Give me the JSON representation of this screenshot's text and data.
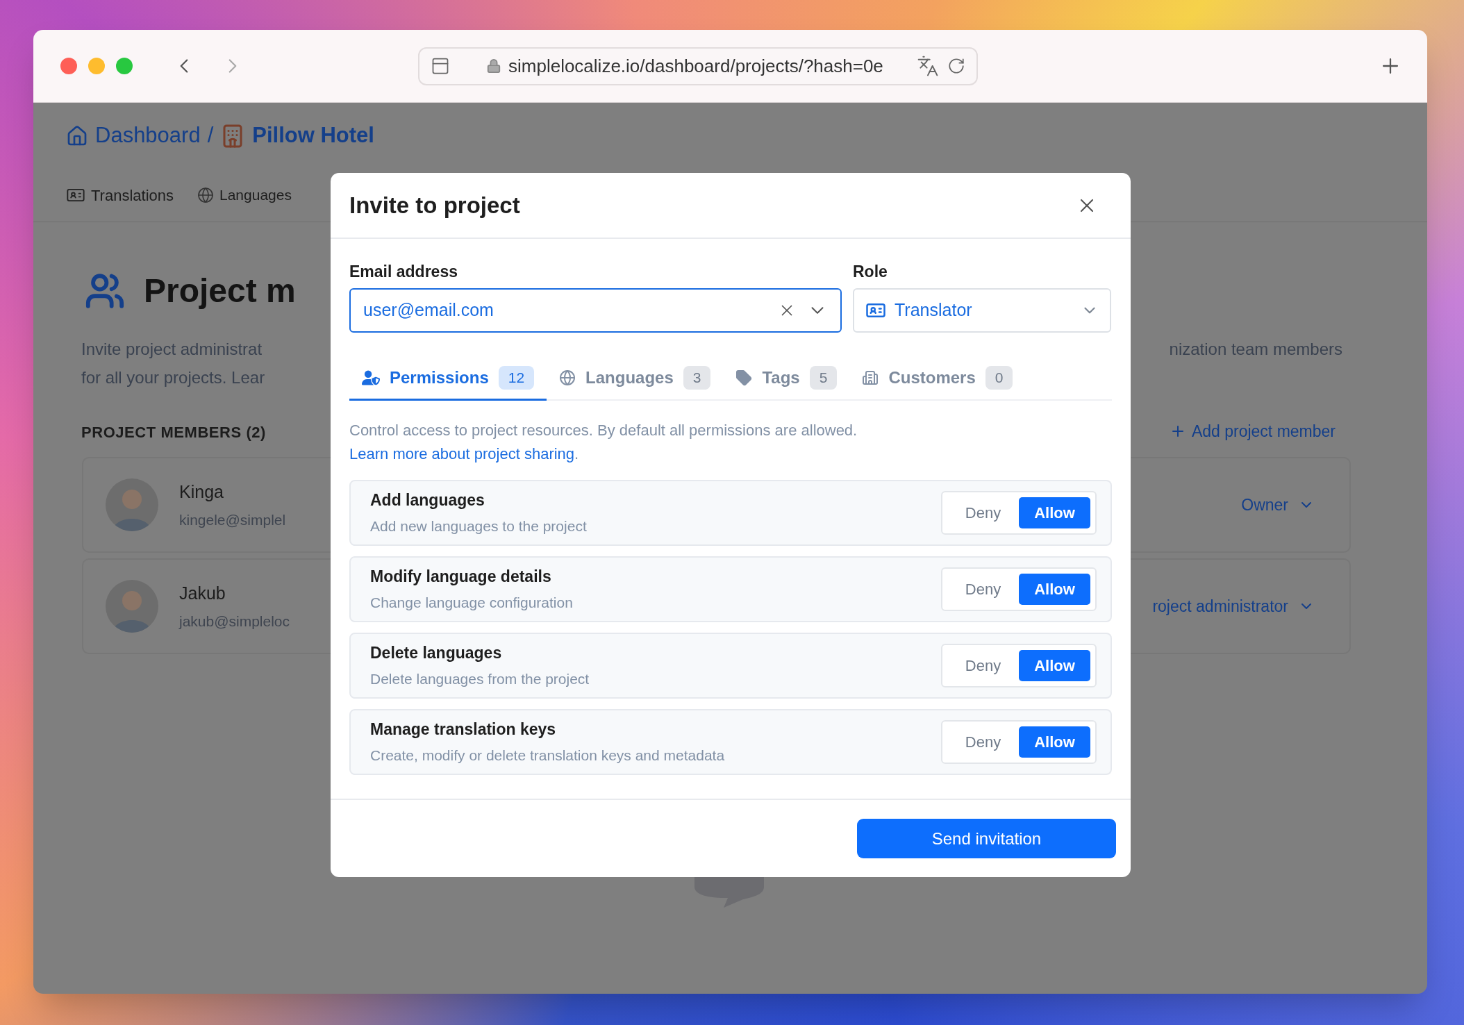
{
  "browser": {
    "url": "simplelocalize.io/dashboard/projects/?hash=0e"
  },
  "page": {
    "breadcrumb": {
      "home": "Dashboard",
      "separator": "/",
      "project": "Pillow Hotel"
    },
    "tabs": [
      "Translations",
      "Languages"
    ],
    "heading": "Project m",
    "description": [
      "Invite project administrat",
      "for all your projects. Lear"
    ],
    "description_right": "nization team members",
    "members_title": "PROJECT MEMBERS (2)",
    "add_member": "Add project member",
    "members": [
      {
        "name": "Kinga",
        "email": "kingele@simplel",
        "role": "Owner"
      },
      {
        "name": "Jakub",
        "email": "jakub@simpleloc",
        "role": "roject administrator"
      }
    ]
  },
  "modal": {
    "title": "Invite to project",
    "email": {
      "label": "Email address",
      "value": "user@email.com"
    },
    "role": {
      "label": "Role",
      "value": "Translator"
    },
    "tabs": [
      {
        "kind": "permissions",
        "label": "Permissions",
        "count": "12",
        "selected": true
      },
      {
        "kind": "languages",
        "label": "Languages",
        "count": "3",
        "selected": false
      },
      {
        "kind": "tags",
        "label": "Tags",
        "count": "5",
        "selected": false
      },
      {
        "kind": "customers",
        "label": "Customers",
        "count": "0",
        "selected": false
      }
    ],
    "description": {
      "text": "Control access to project resources. By default all permissions are allowed.",
      "link": "Learn more about project sharing",
      "tail": "."
    },
    "permissions": [
      {
        "title": "Add languages",
        "subtitle": "Add new languages to the project",
        "options": [
          {
            "label": "Deny",
            "selected": false
          },
          {
            "label": "Allow",
            "selected": true
          }
        ]
      },
      {
        "title": "Modify language details",
        "subtitle": "Change language configuration",
        "options": [
          {
            "label": "Deny",
            "selected": false
          },
          {
            "label": "Allow",
            "selected": true
          }
        ]
      },
      {
        "title": "Delete languages",
        "subtitle": "Delete languages from the project",
        "options": [
          {
            "label": "Deny",
            "selected": false
          },
          {
            "label": "Allow",
            "selected": true
          }
        ]
      },
      {
        "title": "Manage translation keys",
        "subtitle": "Create, modify or delete translation keys and metadata",
        "options": [
          {
            "label": "Deny",
            "selected": false
          },
          {
            "label": "Allow",
            "selected": true
          }
        ]
      }
    ],
    "send": "Send invitation"
  }
}
